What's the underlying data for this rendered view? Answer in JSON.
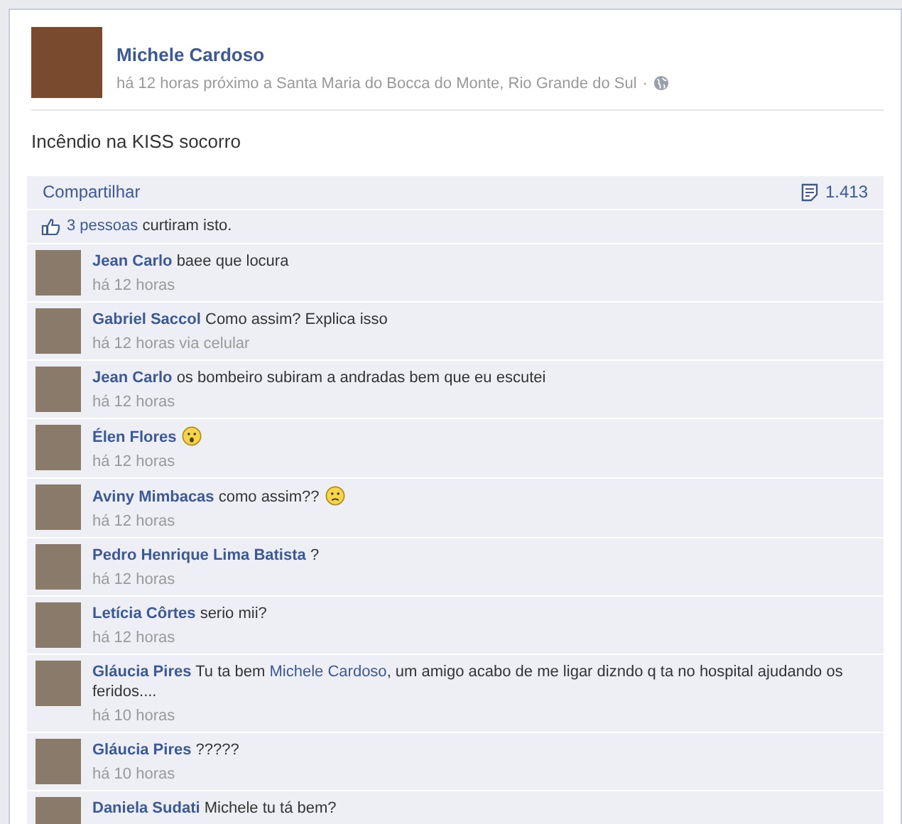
{
  "post": {
    "author": "Michele Cardoso",
    "meta": "há 12 horas próximo a Santa Maria do Bocca do Monte, Rio Grande do Sul",
    "separator": "·",
    "text": "Incêndio na KISS socorro"
  },
  "actions": {
    "share": "Compartilhar",
    "count": "1.413"
  },
  "likes": {
    "people": "3 pessoas",
    "rest": "curtiram isto."
  },
  "comments": [
    {
      "name": "Jean Carlo",
      "parts": [
        {
          "kind": "text",
          "text": "baee que locura"
        }
      ],
      "time": "há 12 horas"
    },
    {
      "name": "Gabriel Saccol",
      "parts": [
        {
          "kind": "text",
          "text": "Como assim? Explica isso"
        }
      ],
      "time": "há 12 horas via celular"
    },
    {
      "name": "Jean Carlo",
      "parts": [
        {
          "kind": "text",
          "text": "os bombeiro subiram a andradas bem que eu escutei"
        }
      ],
      "time": "há 12 horas"
    },
    {
      "name": "Élen Flores",
      "parts": [
        {
          "kind": "surprised_emoticon"
        }
      ],
      "time": "há 12 horas"
    },
    {
      "name": "Aviny Mimbacas",
      "parts": [
        {
          "kind": "text",
          "text": "como assim??"
        },
        {
          "kind": "sad_emoticon"
        }
      ],
      "time": "há 12 horas"
    },
    {
      "name": "Pedro Henrique Lima Batista",
      "parts": [
        {
          "kind": "text",
          "text": "?"
        }
      ],
      "time": "há 12 horas"
    },
    {
      "name": "Letícia Côrtes",
      "parts": [
        {
          "kind": "text",
          "text": "serio mii?"
        }
      ],
      "time": "há 12 horas"
    },
    {
      "name": "Gláucia Pires",
      "parts": [
        {
          "kind": "text",
          "text": "Tu ta bem"
        },
        {
          "kind": "mention",
          "text": "Michele Cardoso"
        },
        {
          "kind": "text",
          "text": ", um amigo acabo de me ligar dizndo q ta no hospital ajudando os feridos...."
        }
      ],
      "time": "há 10 horas"
    },
    {
      "name": "Gláucia Pires",
      "parts": [
        {
          "kind": "text",
          "text": "?????"
        }
      ],
      "time": "há 10 horas"
    },
    {
      "name": "Daniela Sudati",
      "parts": [
        {
          "kind": "text",
          "text": "Michele tu tá bem?"
        }
      ]
    }
  ]
}
